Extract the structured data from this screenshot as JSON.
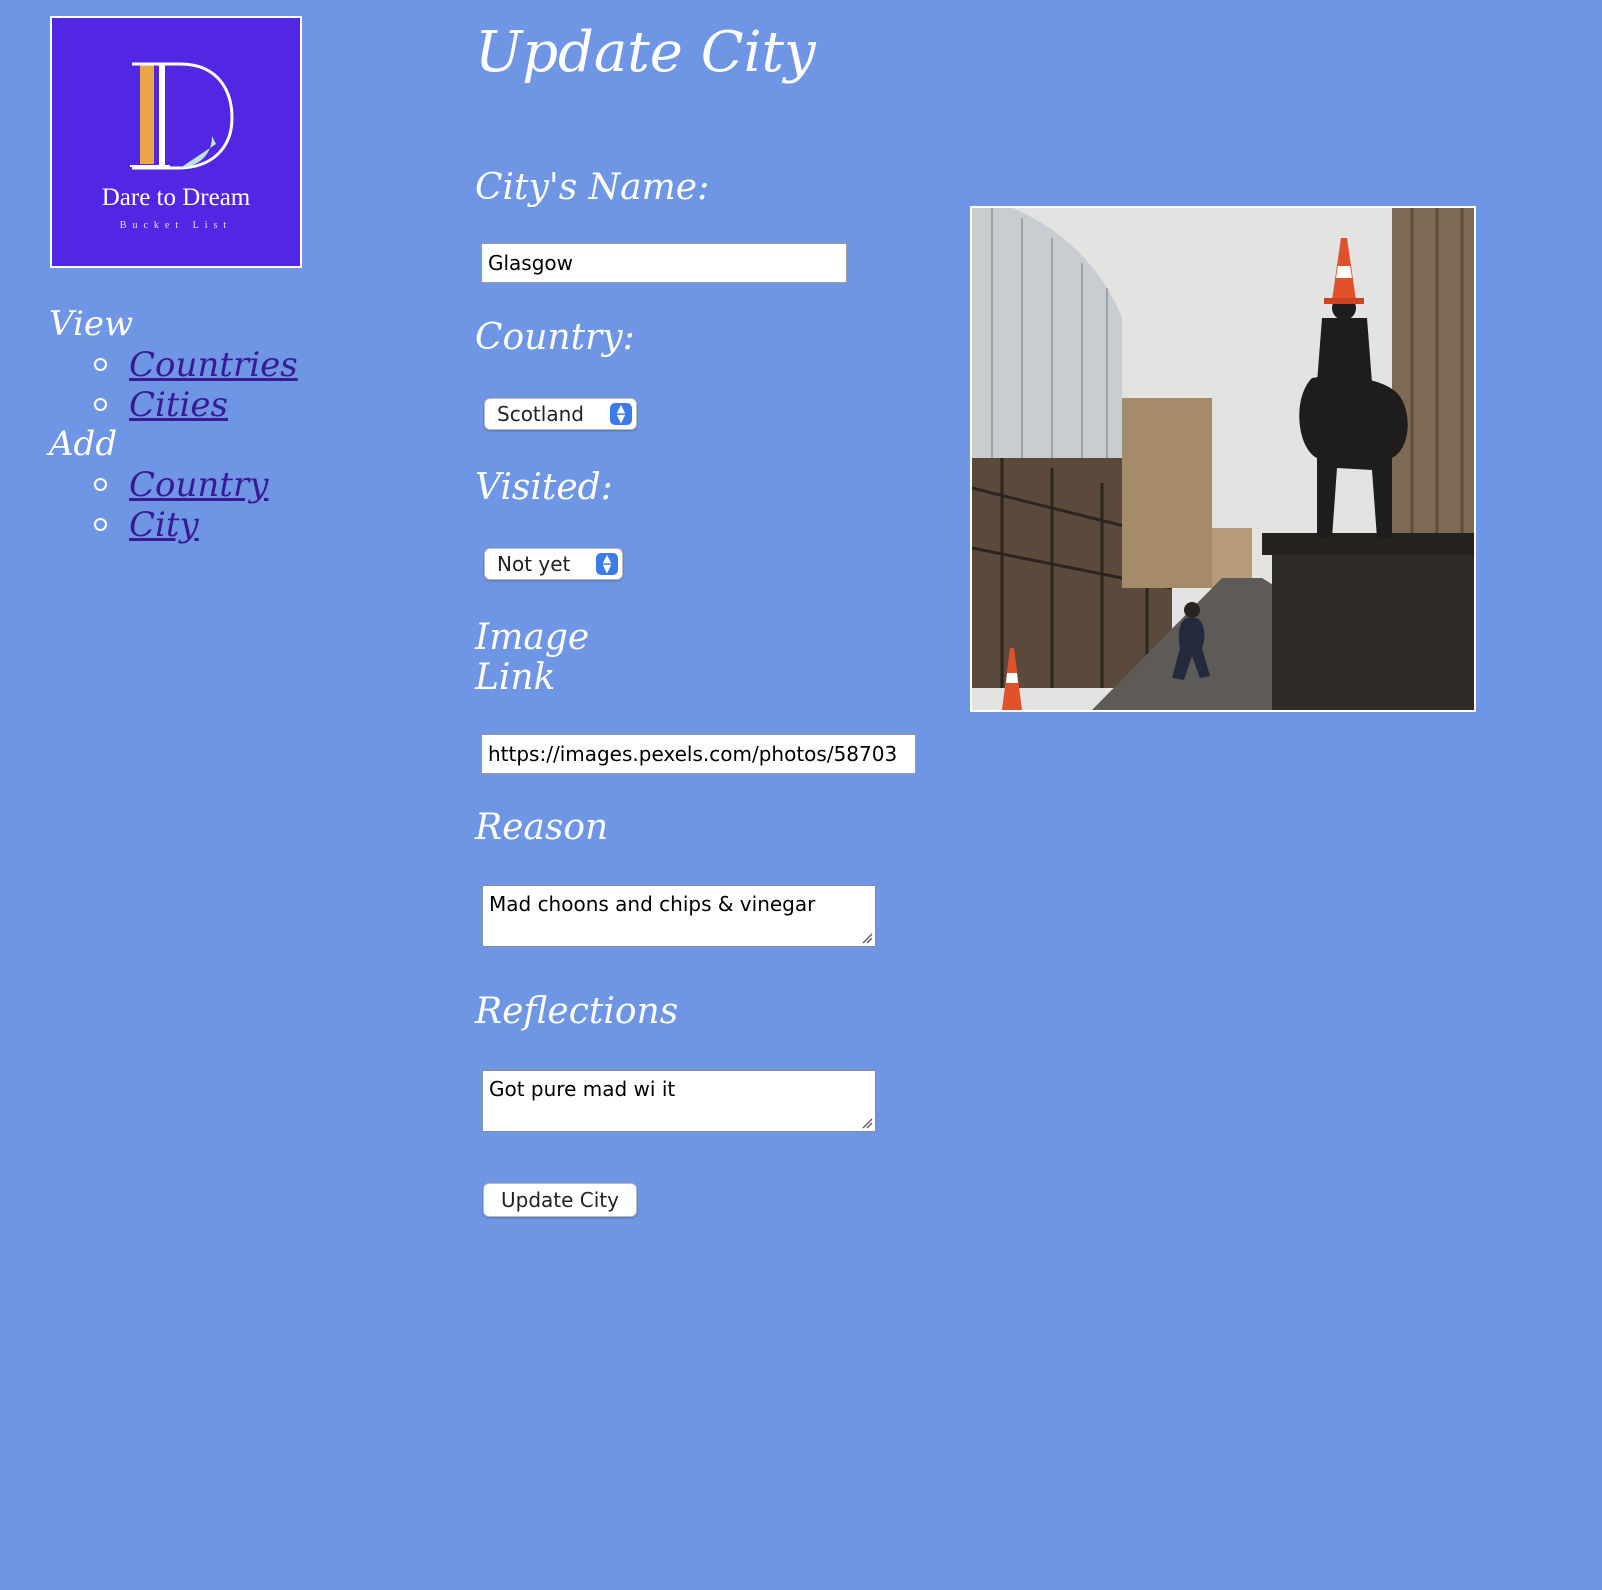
{
  "logo": {
    "title": "Dare to Dream",
    "subtitle": "Bucket List"
  },
  "nav": {
    "view_heading": "View",
    "view_items": [
      {
        "label": "Countries"
      },
      {
        "label": "Cities"
      }
    ],
    "add_heading": "Add",
    "add_items": [
      {
        "label": "Country"
      },
      {
        "label": "City"
      }
    ]
  },
  "page": {
    "title": "Update City"
  },
  "form": {
    "city_name": {
      "label": "City's Name:",
      "value": "Glasgow"
    },
    "country": {
      "label": "Country:",
      "selected": "Scotland"
    },
    "visited": {
      "label": "Visited:",
      "selected": "Not yet"
    },
    "image_link": {
      "label_line1": "Image",
      "label_line2": "Link",
      "value": "https://images.pexels.com/photos/58703"
    },
    "reason": {
      "label": "Reason",
      "value": "Mad choons and chips & vinegar"
    },
    "reflections": {
      "label": "Reflections",
      "value": "Got pure mad wi it"
    },
    "submit_label": "Update City"
  },
  "colors": {
    "background": "#6f96e5",
    "logo_bg": "#5227e4",
    "link": "#3a1a94",
    "select_accent": "#3d7ce8"
  },
  "icons": {
    "select_arrows": "updown-chevron-icon",
    "textarea_grip": "resize-grip-icon"
  }
}
